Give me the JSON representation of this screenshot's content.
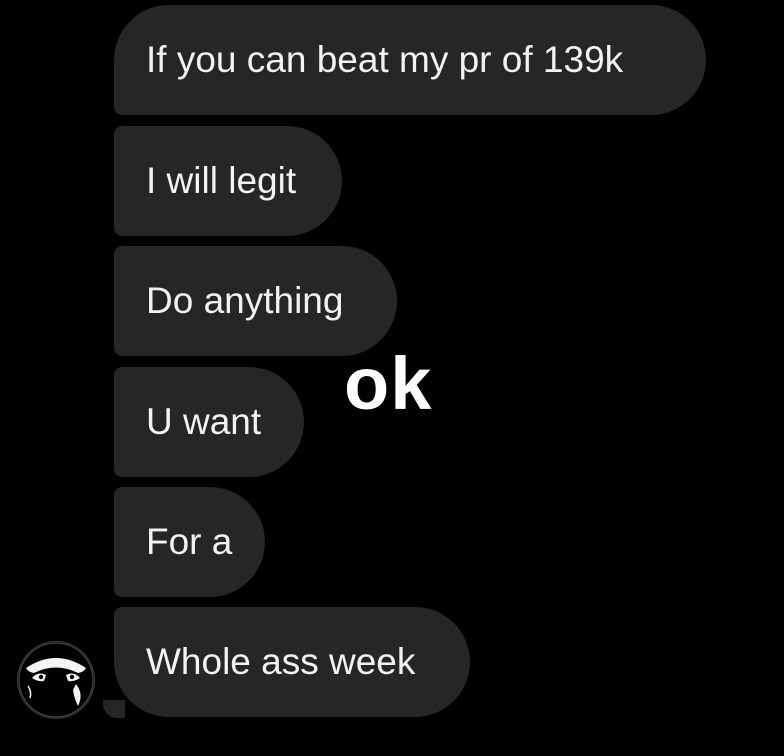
{
  "conversation": {
    "messages": [
      {
        "text": "If you can beat my pr of 139k"
      },
      {
        "text": "I will legit"
      },
      {
        "text": "Do anything"
      },
      {
        "text": "U want"
      },
      {
        "text": "For a"
      },
      {
        "text": "Whole ass week"
      }
    ],
    "overlay_caption": "ok",
    "avatar_icon": "masked-face-icon",
    "colors": {
      "background": "#000000",
      "bubble": "#262626",
      "text": "#f2f2f2"
    }
  }
}
